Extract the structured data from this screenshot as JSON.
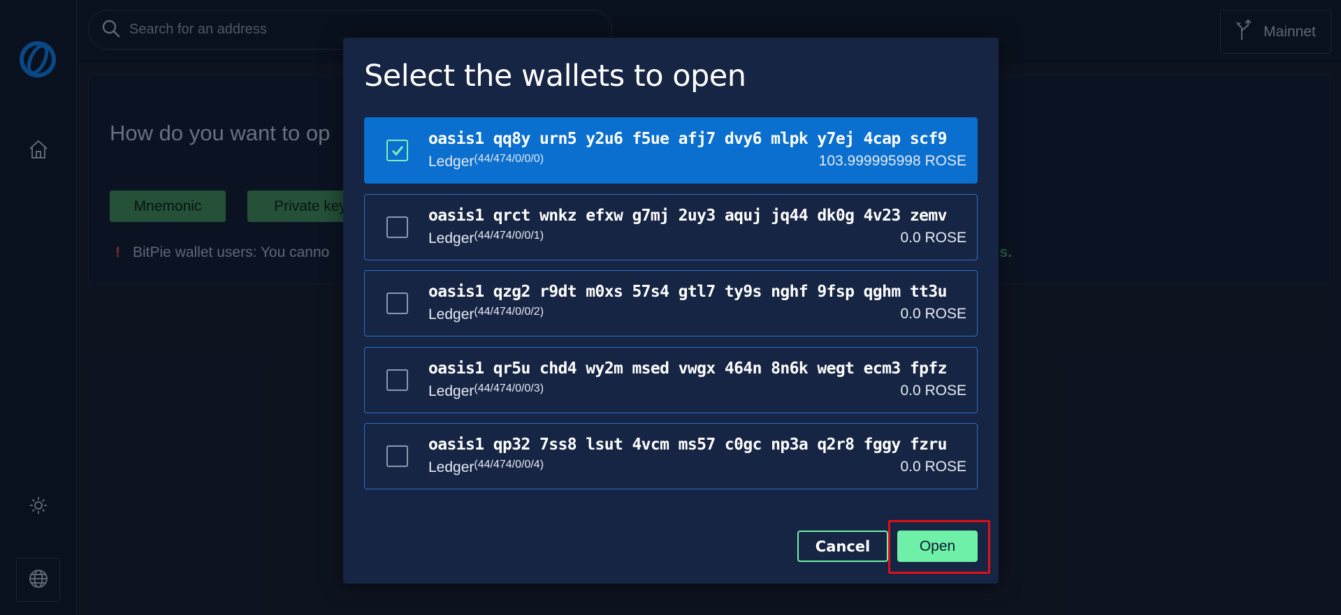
{
  "search": {
    "placeholder": "Search for an address"
  },
  "network": {
    "label": "Mainnet"
  },
  "card": {
    "title": "How do you want to op",
    "mnemonic_label": "Mnemonic",
    "private_key_label": "Private key",
    "notice_text": "BitPie wallet users: You canno",
    "notice_link": "ails."
  },
  "modal": {
    "title": "Select the wallets to open",
    "wallets": [
      {
        "address": "oasis1 qq8y urn5 y2u6 f5ue afj7 dvy6 mlpk y7ej 4cap scf9",
        "source": "Ledger",
        "path": "(44/474/0/0/0)",
        "balance": "103.999995998 ROSE",
        "selected": true
      },
      {
        "address": "oasis1 qrct wnkz efxw g7mj 2uy3 aquj jq44 dk0g 4v23 zemv",
        "source": "Ledger",
        "path": "(44/474/0/0/1)",
        "balance": "0.0 ROSE",
        "selected": false
      },
      {
        "address": "oasis1 qzg2 r9dt m0xs 57s4 gtl7 ty9s nghf 9fsp qghm tt3u",
        "source": "Ledger",
        "path": "(44/474/0/0/2)",
        "balance": "0.0 ROSE",
        "selected": false
      },
      {
        "address": "oasis1 qr5u chd4 wy2m msed vwgx 464n 8n6k wegt ecm3 fpfz",
        "source": "Ledger",
        "path": "(44/474/0/0/3)",
        "balance": "0.0 ROSE",
        "selected": false
      },
      {
        "address": "oasis1 qp32 7ss8 lsut 4vcm ms57 c0gc np3a q2r8 fggy fzru",
        "source": "Ledger",
        "path": "(44/474/0/0/4)",
        "balance": "0.0 ROSE",
        "selected": false
      }
    ],
    "cancel_label": "Cancel",
    "open_label": "Open"
  },
  "colors": {
    "accent_green": "#6ef0a8",
    "selected_blue": "#0a6fcf",
    "modal_bg": "#162543",
    "highlight_red": "#e00f17"
  }
}
